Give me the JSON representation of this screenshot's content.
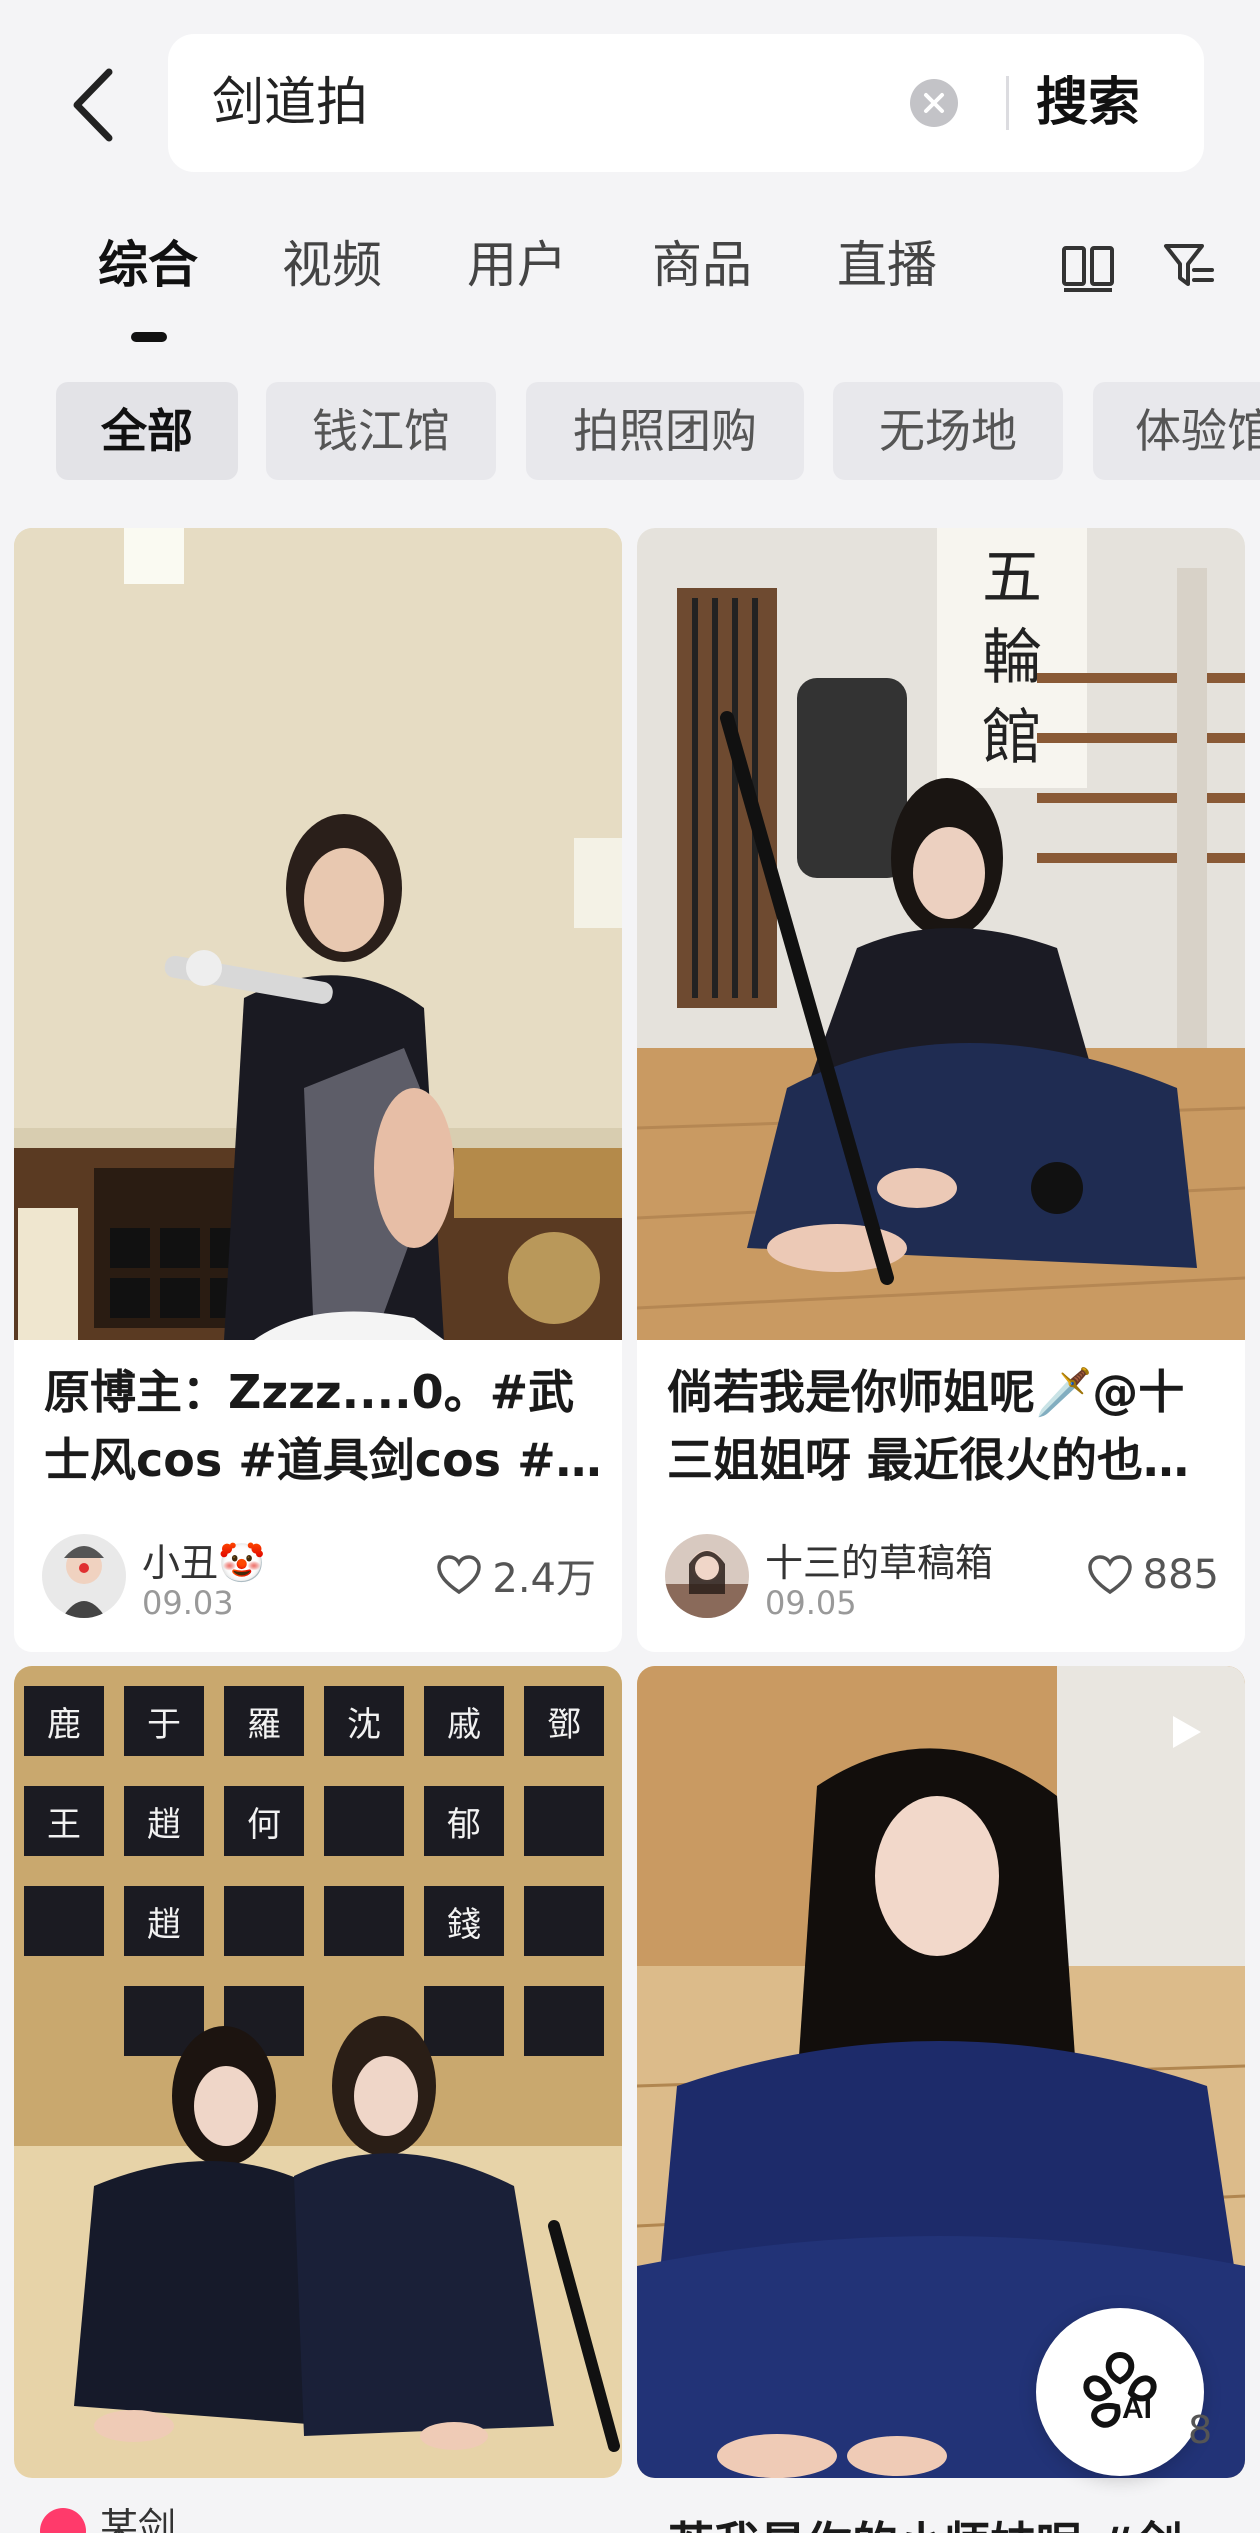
{
  "search": {
    "query": "剑道拍",
    "button_label": "搜索"
  },
  "tabs": [
    {
      "label": "综合",
      "active": true
    },
    {
      "label": "视频"
    },
    {
      "label": "用户"
    },
    {
      "label": "商品"
    },
    {
      "label": "直播"
    }
  ],
  "chips": [
    {
      "label": "全部",
      "active": true
    },
    {
      "label": "钱江馆"
    },
    {
      "label": "拍照团购"
    },
    {
      "label": "无场地"
    },
    {
      "label": "体验馆"
    }
  ],
  "cards": [
    {
      "title": "原博主：Zzzz....0。#武士风cos #道具剑cos #…",
      "author": "小丑🤡",
      "date": "09.03",
      "likes": "2.4万",
      "image_description_icon": "kendo-photo"
    },
    {
      "title": "倘若我是你师姐呢🗡️@十三姐姐呀 最近很火的也…",
      "author": "十三的草稿箱",
      "date": "09.05",
      "likes": "885",
      "image_description_icon": "kendo-photo"
    },
    {
      "title": "",
      "author": "",
      "date": "",
      "likes": "",
      "image_description_icon": "kendo-photo"
    },
    {
      "title": "",
      "author": "",
      "date": "",
      "likes": "",
      "image_description_icon": "kendo-photo",
      "has_video": true
    }
  ],
  "bottom": {
    "left_author": "某剑",
    "right_title": "若我是你的小师妹呢 #剑"
  },
  "floating": {
    "ai_label": "AI",
    "partial_count": "8"
  },
  "colors": {
    "background": "#f4f4f6",
    "card": "#ffffff",
    "chip": "#e8e8ec",
    "text_primary": "#111111",
    "text_secondary": "#999999",
    "kendo_navy": "#1c2a4d"
  }
}
